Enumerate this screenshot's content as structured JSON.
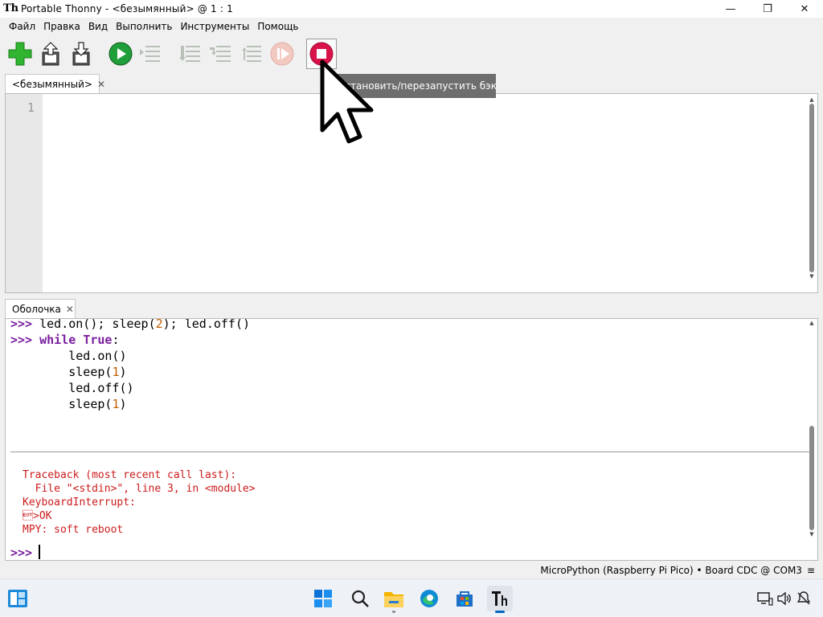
{
  "window": {
    "title": "Portable Thonny  -  <безымянный>  @  1 : 1",
    "app_icon": "Th",
    "controls": {
      "minimize": "—",
      "maximize": "❐",
      "close": "✕"
    }
  },
  "menu": [
    "Файл",
    "Правка",
    "Вид",
    "Выполнить",
    "Инструменты",
    "Помощь"
  ],
  "toolbar": {
    "buttons": [
      "new-file-icon",
      "open-file-icon",
      "save-file-icon",
      "run-icon",
      "debug-icon",
      "step-over-icon",
      "step-into-icon",
      "step-out-icon",
      "resume-icon",
      "stop-icon"
    ],
    "colors": {
      "new": "#2fb52f",
      "run": "#1f9e3a",
      "stop": "#d9124a",
      "disabled": "#b8c0b8"
    }
  },
  "tooltip": {
    "text": "Остановить/перезапустить бэкенд"
  },
  "editor": {
    "tab_label": "<безымянный>",
    "tab_close": "✕",
    "line_numbers": [
      "1"
    ]
  },
  "shell": {
    "tab_label": "Оболочка",
    "tab_close": "✕",
    "prompt": ">>>",
    "line1": {
      "a": "led.on(); sleep(",
      "n1": "2",
      "b": "); led.off()"
    },
    "line2": {
      "kw_while": "while",
      "kw_true": "True",
      "colon": ":"
    },
    "body": [
      {
        "pre": "    led.on()",
        "num": "",
        "post": ""
      },
      {
        "pre": "    sleep(",
        "num": "1",
        "post": ")"
      },
      {
        "pre": "    led.off()",
        "num": "",
        "post": ""
      },
      {
        "pre": "    sleep(",
        "num": "1",
        "post": ")"
      }
    ],
    "traceback": [
      "Traceback (most recent call last):",
      "  File \"<stdin>\", line 3, in <module>",
      "KeyboardInterrupt:",
      "\u0004>OK",
      "MPY: soft reboot"
    ]
  },
  "statusbar": {
    "interpreter": "MicroPython (Raspberry Pi Pico)  •  Board CDC @ COM3",
    "menu_icon": "≡"
  },
  "taskbar": {
    "icons": [
      "widgets-icon",
      "start-icon",
      "search-icon",
      "file-explorer-icon",
      "edge-icon",
      "store-icon",
      "thonny-icon"
    ],
    "tray": [
      "network-icon",
      "volume-icon",
      "notification-icon"
    ]
  }
}
